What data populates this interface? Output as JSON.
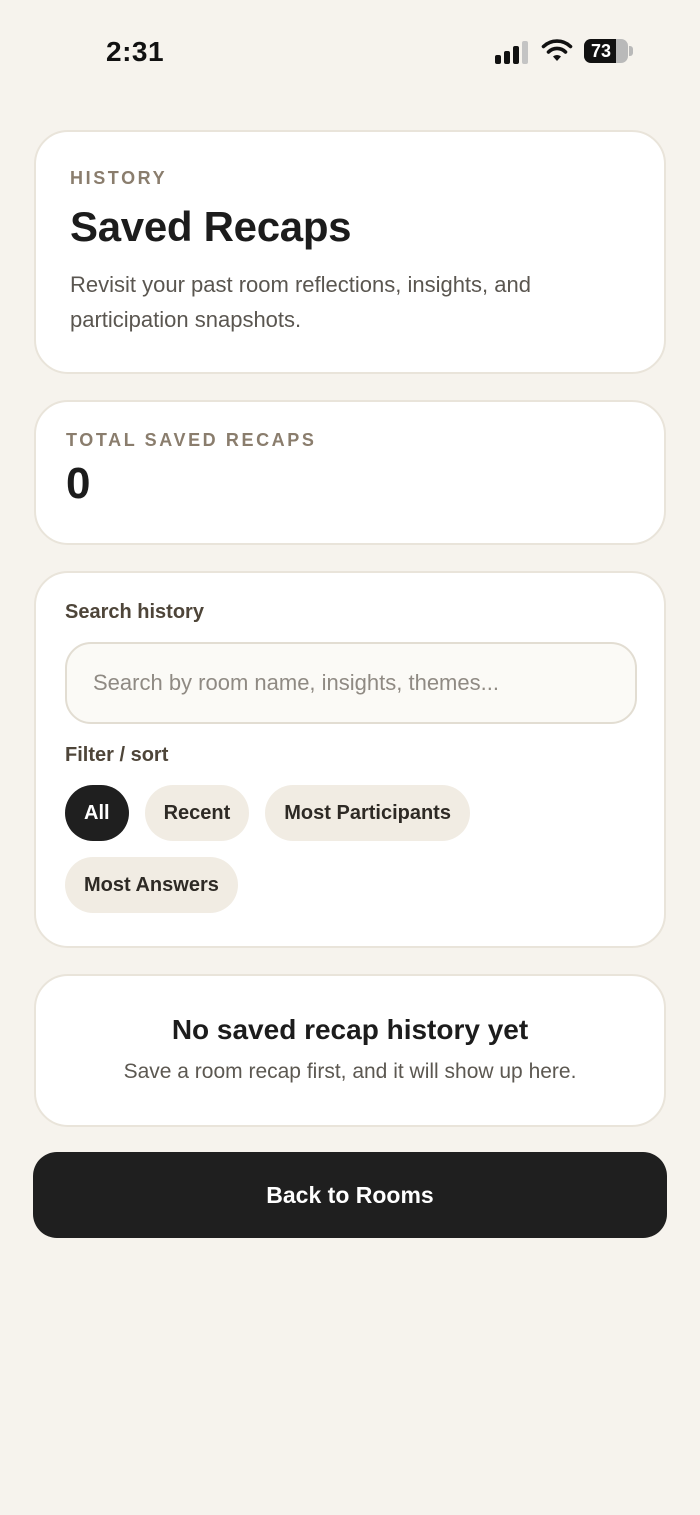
{
  "status_bar": {
    "time": "2:31",
    "battery_percent": "73",
    "signal_icon": "signal-bars-icon",
    "wifi_icon": "wifi-icon",
    "battery_icon": "battery-icon"
  },
  "header": {
    "eyebrow": "HISTORY",
    "title": "Saved Recaps",
    "description": "Revisit your past room reflections, insights, and participation snapshots."
  },
  "stats": {
    "label": "TOTAL SAVED RECAPS",
    "value": "0"
  },
  "search": {
    "label": "Search history",
    "placeholder": "Search by room name, insights, themes...",
    "value": ""
  },
  "filter": {
    "label": "Filter / sort",
    "options": [
      "All",
      "Recent",
      "Most Participants",
      "Most Answers"
    ],
    "selected": "All"
  },
  "empty_state": {
    "title": "No saved recap history yet",
    "message": "Save a room recap first, and it will show up here."
  },
  "actions": {
    "back_label": "Back to Rooms"
  },
  "colors": {
    "background": "#f6f3ed",
    "card": "#ffffff",
    "primary": "#1f1f1f",
    "chip": "#f1ece3",
    "eyebrow": "#8a7d6d"
  }
}
